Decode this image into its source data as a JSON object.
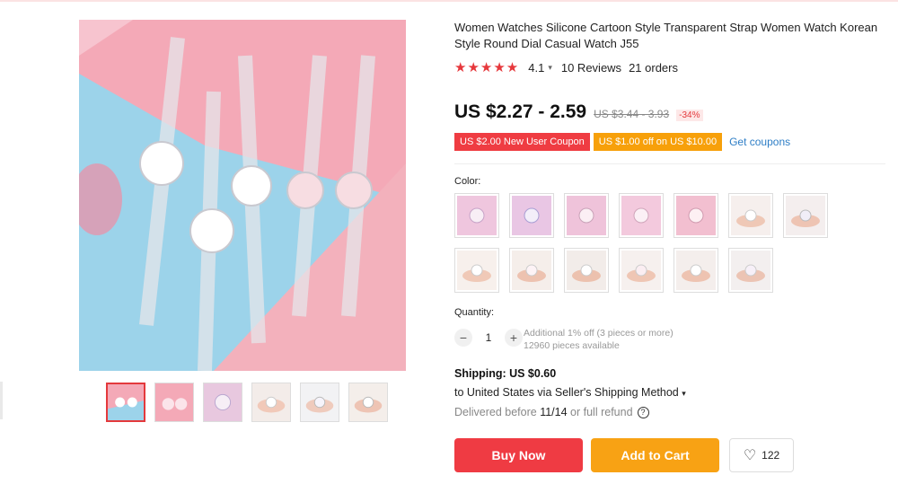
{
  "product": {
    "title": "Women Watches Silicone Cartoon Style Transparent Strap Women Watch Korean Style Round Dial Casual Watch J55",
    "rating": "4.1",
    "rating_stars": "★★★★★",
    "reviews": "10 Reviews",
    "orders": "21 orders"
  },
  "pricing": {
    "price": "US $2.27 - 2.59",
    "original": "US $3.44 - 3.93",
    "discount": "-34%"
  },
  "coupons": {
    "new_user": "US $2.00 New User Coupon",
    "store": "US $1.00 off on US $10.00",
    "get": "Get coupons"
  },
  "color": {
    "label": "Color:",
    "swatch_count": 13
  },
  "quantity": {
    "label": "Quantity:",
    "value": "1",
    "minus": "−",
    "plus": "+",
    "note1": "Additional 1% off (3 pieces or more)",
    "note2": "12960 pieces available"
  },
  "shipping": {
    "title": "Shipping: US $0.60",
    "to": "to United States via Seller's Shipping Method",
    "delivered_prefix": "Delivered before",
    "date": "11/14",
    "suffix": "or full refund"
  },
  "actions": {
    "buy": "Buy Now",
    "cart": "Add to Cart",
    "wishlist_count": "122"
  },
  "colors": {
    "accent": "#ef3b43",
    "cart": "#f8a214",
    "link": "#2e7ec6"
  }
}
